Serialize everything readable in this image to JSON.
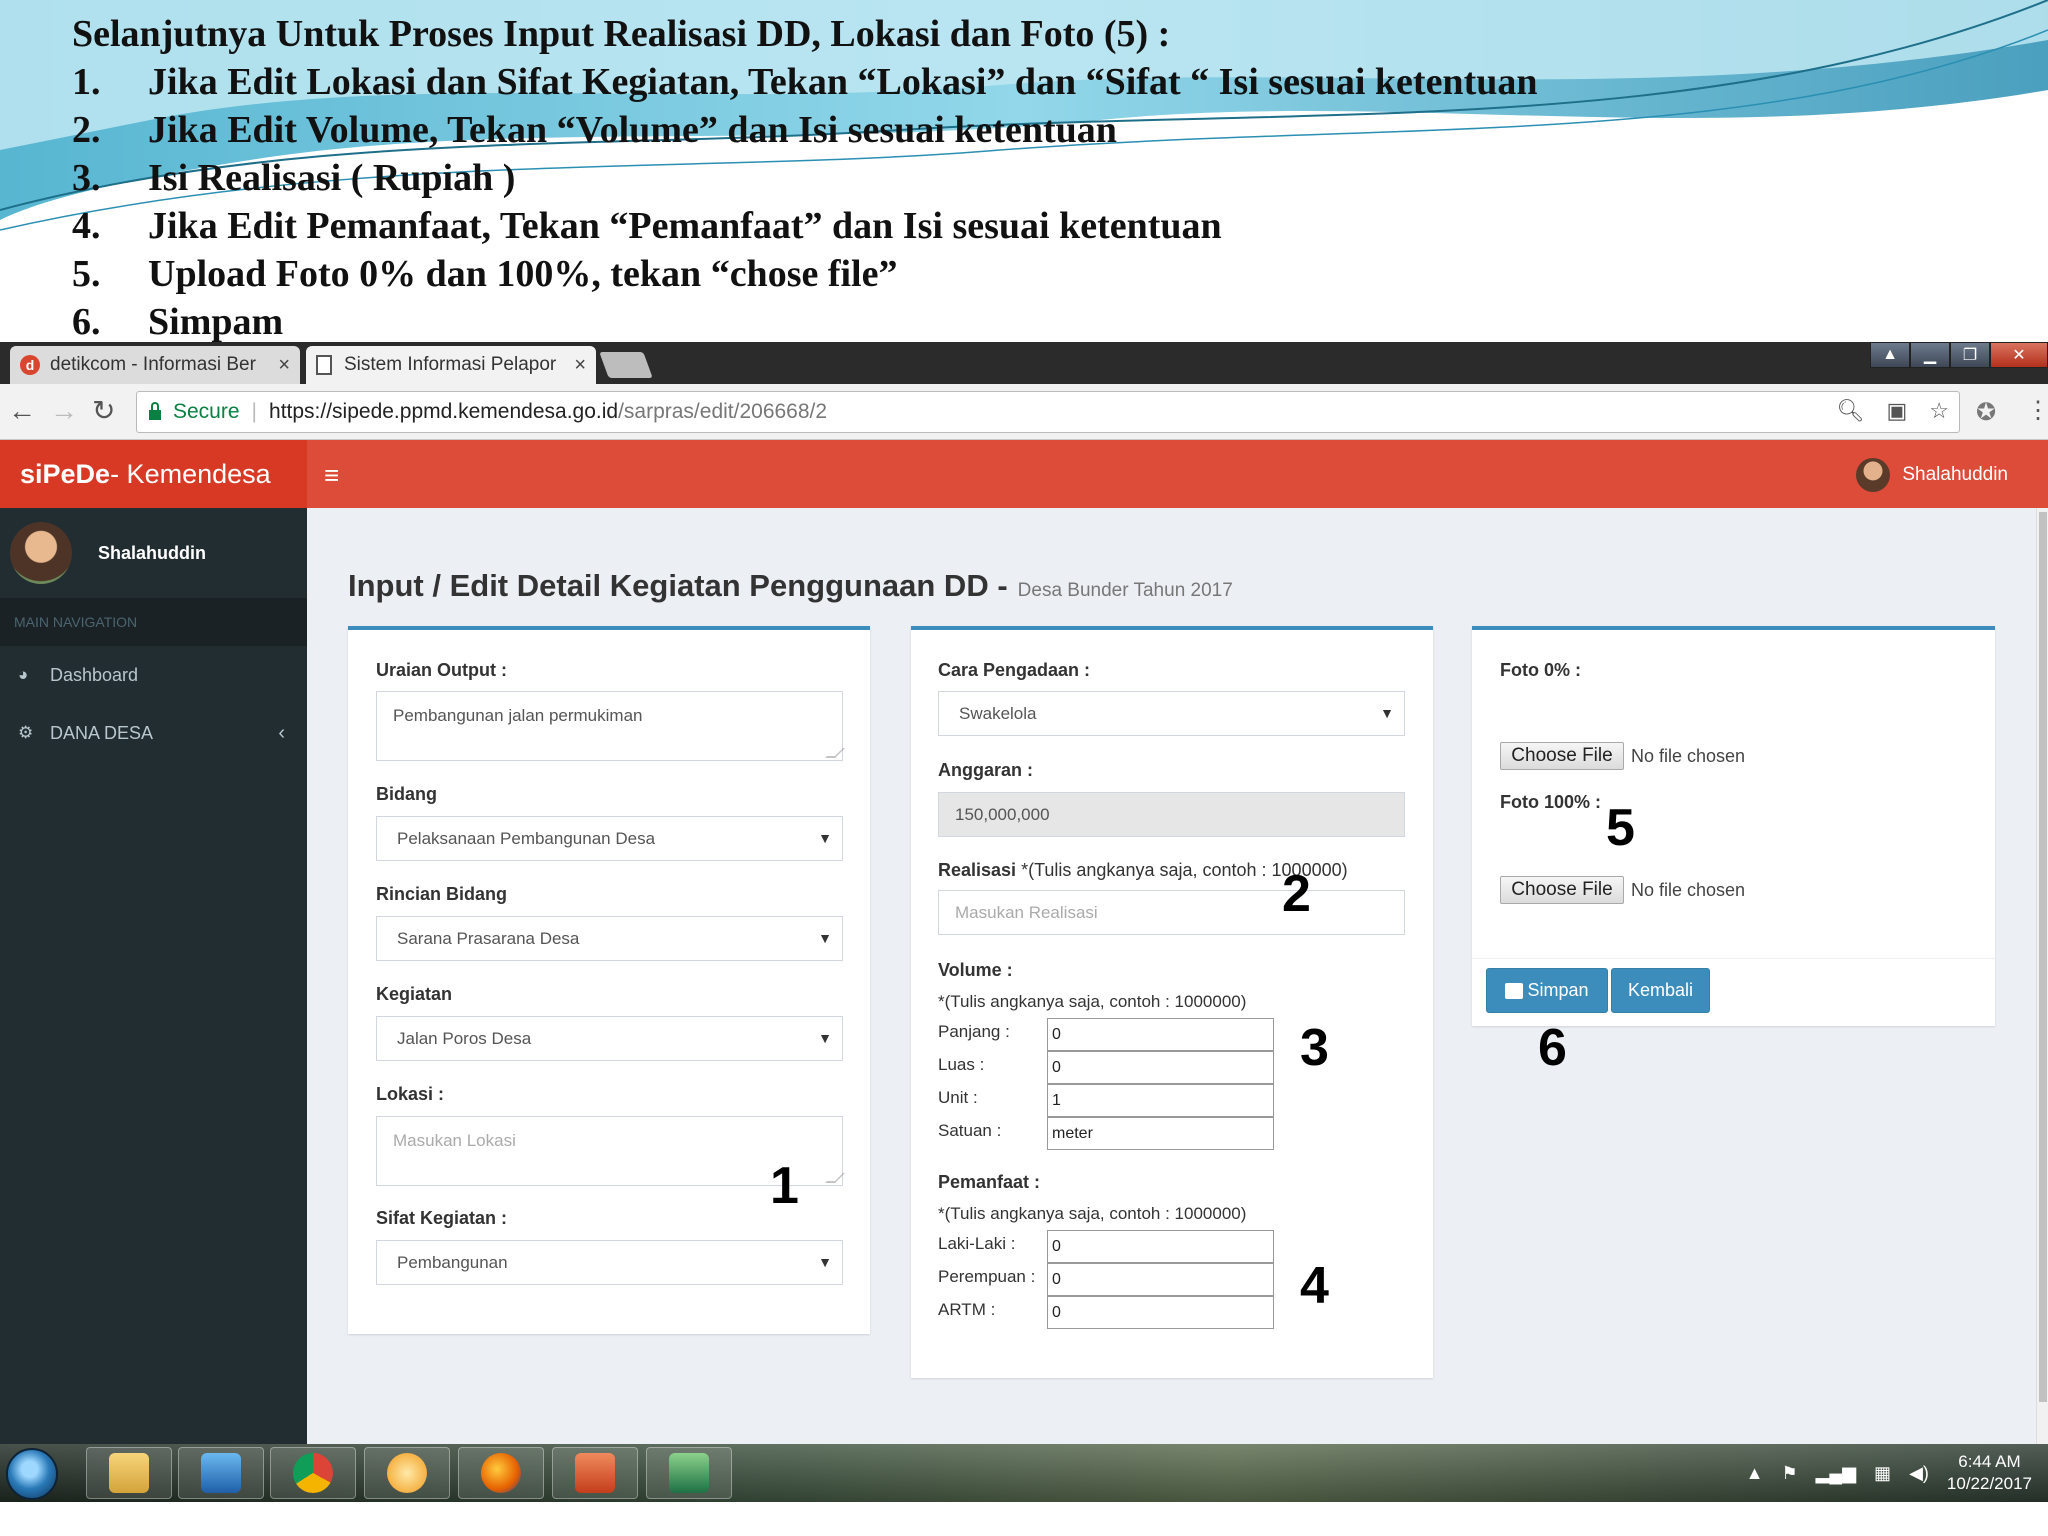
{
  "slide": {
    "title": "Selanjutnya Untuk Proses Input Realisasi DD, Lokasi dan Foto (5) :",
    "steps": [
      {
        "num": "1.",
        "text": "Jika Edit Lokasi dan Sifat Kegiatan, Tekan “Lokasi” dan “Sifat “ Isi sesuai ketentuan"
      },
      {
        "num": "2.",
        "text": "Jika Edit Volume, Tekan  “Volume” dan Isi sesuai ketentuan"
      },
      {
        "num": "3.",
        "text": "Isi Realisasi ( Rupiah )"
      },
      {
        "num": "4.",
        "text": "Jika Edit Pemanfaat, Tekan “Pemanfaat” dan Isi sesuai ketentuan"
      },
      {
        "num": "5.",
        "text": "Upload Foto 0% dan 100%, tekan  “chose file”"
      },
      {
        "num": "6.",
        "text": "Simpam"
      }
    ]
  },
  "browser": {
    "tabs": [
      {
        "label": "detikcom - Informasi Ber",
        "close": "×",
        "favicon": "d"
      },
      {
        "label": "Sistem Informasi Pelapor",
        "close": "×"
      }
    ],
    "secure_label": "Secure",
    "url_base": "https://sipede.ppmd.kemendesa.go.id",
    "url_path": "/sarpras/edit/206668/2"
  },
  "app": {
    "logo_bold": "siPeDe",
    "logo_rest": " - Kemendesa",
    "user_name": "Shalahuddin",
    "nav_header": "MAIN NAVIGATION",
    "nav_items": [
      {
        "label": "Dashboard",
        "icon": "dashboard-icon"
      },
      {
        "label": "DANA DESA",
        "icon": "gears-icon"
      }
    ],
    "page_title": "Input / Edit Detail Kegiatan Penggunaan DD -",
    "page_subtitle": "Desa Bunder Tahun 2017"
  },
  "form_left": {
    "uraian_label": "Uraian Output :",
    "uraian_value": "Pembangunan jalan permukiman",
    "bidang_label": "Bidang",
    "bidang_value": "Pelaksanaan Pembangunan Desa",
    "rincian_label": "Rincian Bidang",
    "rincian_value": "Sarana Prasarana Desa",
    "kegiatan_label": "Kegiatan",
    "kegiatan_value": "Jalan Poros Desa",
    "lokasi_label": "Lokasi :",
    "lokasi_placeholder": "Masukan Lokasi",
    "sifat_label": "Sifat Kegiatan :",
    "sifat_value": "Pembangunan"
  },
  "form_mid": {
    "cara_label": "Cara Pengadaan :",
    "cara_value": "Swakelola",
    "anggaran_label": "Anggaran :",
    "anggaran_value": "150,000,000",
    "realisasi_label": "Realisasi",
    "realisasi_hint": " *(Tulis angkanya saja, contoh : 1000000)",
    "realisasi_placeholder": "Masukan Realisasi",
    "volume_label": "Volume :",
    "volume_note": "*(Tulis angkanya saja, contoh : 1000000)",
    "panjang_label": "Panjang :",
    "panjang_value": "0",
    "luas_label": "Luas :",
    "luas_value": "0",
    "unit_label": "Unit :",
    "unit_value": "1",
    "satuan_label": "Satuan :",
    "satuan_value": "meter",
    "pemanfaat_label": "Pemanfaat :",
    "pemanfaat_note": "*(Tulis angkanya saja, contoh : 1000000)",
    "laki_label": "Laki-Laki :",
    "laki_value": "0",
    "perempuan_label": "Perempuan :",
    "perempuan_value": "0",
    "artm_label": "ARTM :",
    "artm_value": "0"
  },
  "form_right": {
    "foto0_label": "Foto 0% :",
    "foto100_label": "Foto 100% :",
    "choose_file": "Choose File",
    "no_file": "No file chosen",
    "simpan": "Simpan",
    "kembali": "Kembali"
  },
  "markers": [
    "1",
    "2",
    "3",
    "4",
    "5",
    "6"
  ],
  "taskbar": {
    "time": "6:44 AM",
    "date": "10/22/2017"
  },
  "colors": {
    "header_red": "#dd4b39",
    "sidebar_dark": "#222d32",
    "box_border_blue": "#3c8dbc",
    "secure_green": "#0b8043"
  }
}
